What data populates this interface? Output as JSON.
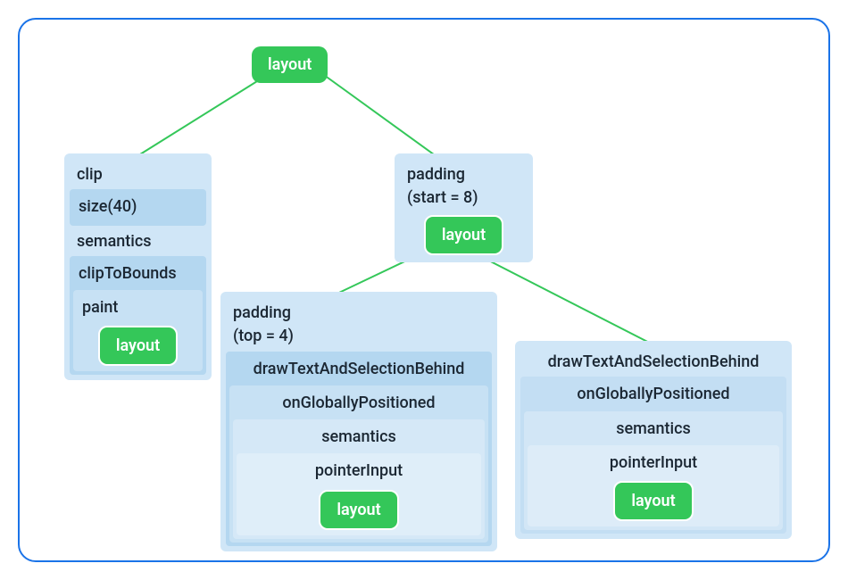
{
  "root": {
    "label": "layout"
  },
  "leftBox": {
    "clip": "clip",
    "size": "size(40)",
    "semantics": "semantics",
    "clipToBounds": "clipToBounds",
    "paint": "paint",
    "layout": "layout"
  },
  "rightBox": {
    "padding_line1": "padding",
    "padding_line2": "(start = 8)",
    "layout": "layout"
  },
  "childLeft": {
    "padding_line1": "padding",
    "padding_line2": "(top = 4)",
    "drawText": "drawTextAndSelectionBehind",
    "onGloballyPositioned": "onGloballyPositioned",
    "semantics": "semantics",
    "pointerInput": "pointerInput",
    "layout": "layout"
  },
  "childRight": {
    "drawText": "drawTextAndSelectionBehind",
    "onGloballyPositioned": "onGloballyPositioned",
    "semantics": "semantics",
    "pointerInput": "pointerInput",
    "layout": "layout"
  }
}
